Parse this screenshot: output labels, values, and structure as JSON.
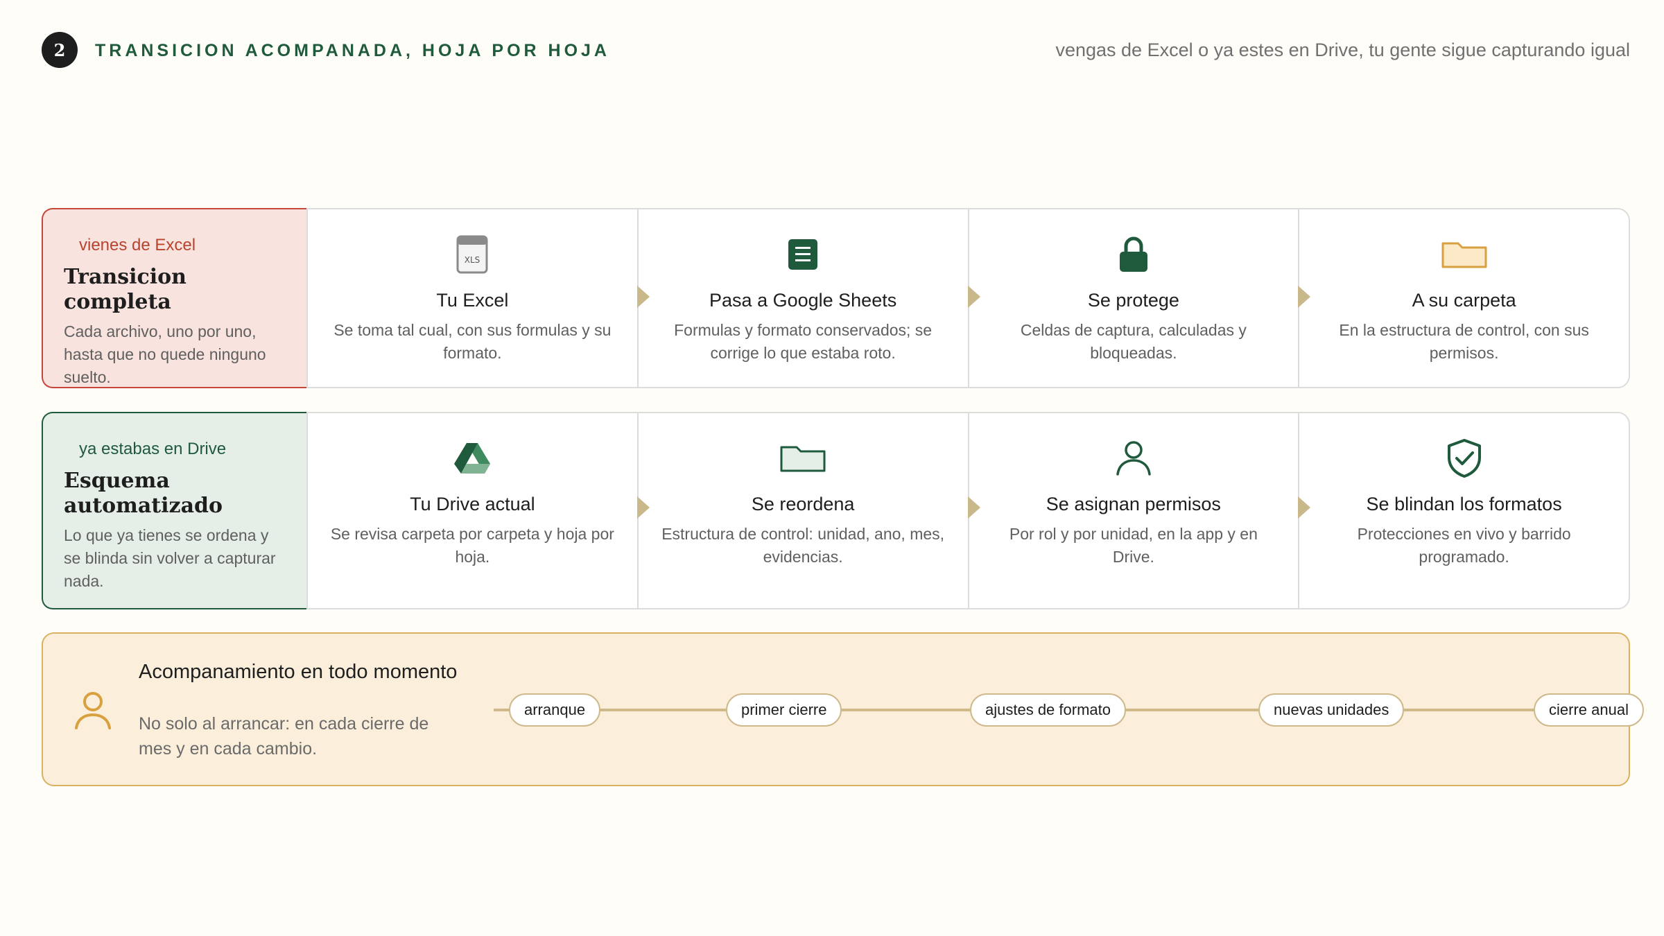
{
  "header": {
    "step_number": "2",
    "kicker": "TRANSICION ACOMPANADA, HOJA POR HOJA",
    "tagline": "vengas de Excel o ya estes en Drive, tu gente sigue capturando igual"
  },
  "colors": {
    "brand_green": "#1f5a3c",
    "excel_red": "#c6463a",
    "accent_gold": "#d9b160",
    "arrow_tan": "#c9b889"
  },
  "excel_row": {
    "label": "vienes de Excel",
    "title": "Transicion completa",
    "description": "Cada archivo, uno por uno, hasta que no quede ninguno suelto.",
    "steps": [
      {
        "icon": "xls-file-icon",
        "title": "Tu Excel",
        "description": "Se toma tal cual, con sus formulas y su formato."
      },
      {
        "icon": "sheets-document-icon",
        "title": "Pasa a Google Sheets",
        "description": "Formulas y formato conservados; se corrige lo que estaba roto."
      },
      {
        "icon": "lock-icon",
        "title": "Se protege",
        "description": "Celdas de captura, calculadas y bloqueadas."
      },
      {
        "icon": "folder-icon",
        "title": "A su carpeta",
        "description": "En la estructura de control, con sus permisos."
      }
    ]
  },
  "drive_row": {
    "label": "ya estabas en Drive",
    "title": "Esquema automatizado",
    "description": "Lo que ya tienes se ordena y se blinda sin volver a capturar nada.",
    "steps": [
      {
        "icon": "google-drive-icon",
        "title": "Tu Drive actual",
        "description": "Se revisa carpeta por carpeta y hoja por hoja."
      },
      {
        "icon": "folder-outline-icon",
        "title": "Se reordena",
        "description": "Estructura de control: unidad, ano, mes, evidencias."
      },
      {
        "icon": "user-icon",
        "title": "Se asignan permisos",
        "description": "Por rol y por unidad, en la app y en Drive."
      },
      {
        "icon": "shield-check-icon",
        "title": "Se blindan los formatos",
        "description": "Protecciones en vivo y barrido programado."
      }
    ]
  },
  "support": {
    "icon": "person-icon",
    "title": "Acompanamiento en todo momento",
    "description": "No solo al arrancar: en cada cierre de mes y en cada cambio.",
    "milestones": [
      "arranque",
      "primer cierre",
      "ajustes de formato",
      "nuevas unidades",
      "cierre anual"
    ]
  }
}
